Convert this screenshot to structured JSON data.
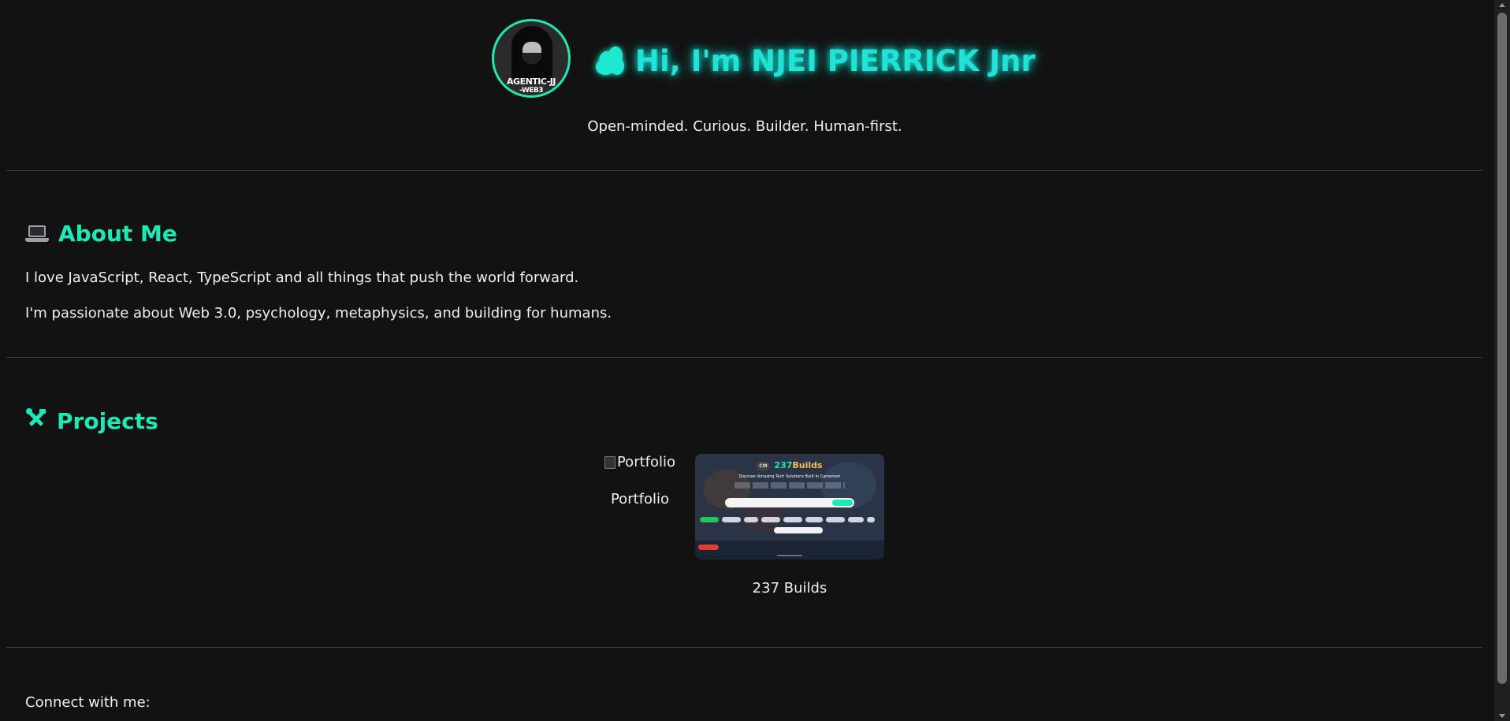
{
  "header": {
    "avatar_caption_line1": "AGENTIC-JJ",
    "avatar_caption_line2": "-WEB3",
    "greeting": "Hi, I'm NJEI PIERRICK Jnr",
    "tagline": "Open-minded. Curious. Builder. Human-first."
  },
  "about": {
    "icon": "laptop-icon",
    "title": "About Me",
    "paragraphs": [
      "I love JavaScript, React, TypeScript and all things that push the world forward.",
      "I'm passionate about Web 3.0, psychology, metaphysics, and building for humans."
    ]
  },
  "projects": {
    "icon": "tools-icon",
    "title": "Projects",
    "items": [
      {
        "image_alt": "Portfolio",
        "label": "Portfolio"
      },
      {
        "image_alt": "237 Builds",
        "label": "237 Builds",
        "thumb_logo_prefix": "CM",
        "thumb_logo_num": "237",
        "thumb_logo_word": "Builds",
        "thumb_headline": "Discover Amazing Tech Solutions Built In Cameroon"
      }
    ]
  },
  "connect": {
    "label": "Connect with me:"
  },
  "colors": {
    "background": "#121212",
    "accent": "#1de9b6",
    "greeting": "#20e3d5",
    "text": "#f0f0f0"
  }
}
